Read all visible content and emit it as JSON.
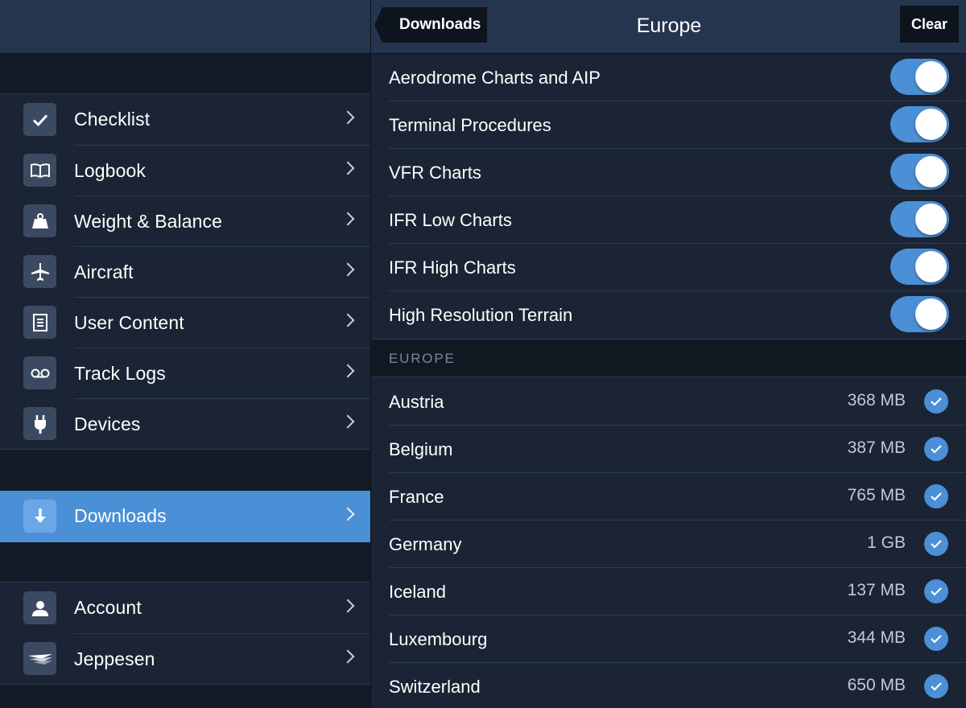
{
  "sidebar": {
    "group1": [
      {
        "label": "Checklist",
        "icon": "checkmark-icon"
      },
      {
        "label": "Logbook",
        "icon": "book-icon"
      },
      {
        "label": "Weight & Balance",
        "icon": "weight-icon"
      },
      {
        "label": "Aircraft",
        "icon": "airplane-icon"
      },
      {
        "label": "User Content",
        "icon": "document-icon"
      },
      {
        "label": "Track Logs",
        "icon": "track-icon"
      },
      {
        "label": "Devices",
        "icon": "plug-icon"
      }
    ],
    "downloads": {
      "label": "Downloads",
      "icon": "download-arrow-icon",
      "active": true
    },
    "group3": [
      {
        "label": "Account",
        "icon": "person-icon"
      },
      {
        "label": "Jeppesen",
        "icon": "jeppesen-logo-icon"
      }
    ]
  },
  "topbar": {
    "back_label": "Downloads",
    "title": "Europe",
    "clear_label": "Clear"
  },
  "toggles": [
    {
      "label": "Aerodrome Charts and AIP",
      "on": true
    },
    {
      "label": "Terminal Procedures",
      "on": true
    },
    {
      "label": "VFR Charts",
      "on": true
    },
    {
      "label": "IFR Low Charts",
      "on": true
    },
    {
      "label": "IFR High Charts",
      "on": true
    },
    {
      "label": "High Resolution Terrain",
      "on": true
    }
  ],
  "section": {
    "title": "EUROPE"
  },
  "regions": [
    {
      "name": "Austria",
      "size": "368 MB",
      "checked": true
    },
    {
      "name": "Belgium",
      "size": "387 MB",
      "checked": true
    },
    {
      "name": "France",
      "size": "765 MB",
      "checked": true
    },
    {
      "name": "Germany",
      "size": "1 GB",
      "checked": true
    },
    {
      "name": "Iceland",
      "size": "137 MB",
      "checked": true
    },
    {
      "name": "Luxembourg",
      "size": "344 MB",
      "checked": true
    },
    {
      "name": "Switzerland",
      "size": "650 MB",
      "checked": true
    }
  ],
  "colors": {
    "accent": "#4b8fd6",
    "background": "#1b2434",
    "header": "#253550"
  }
}
